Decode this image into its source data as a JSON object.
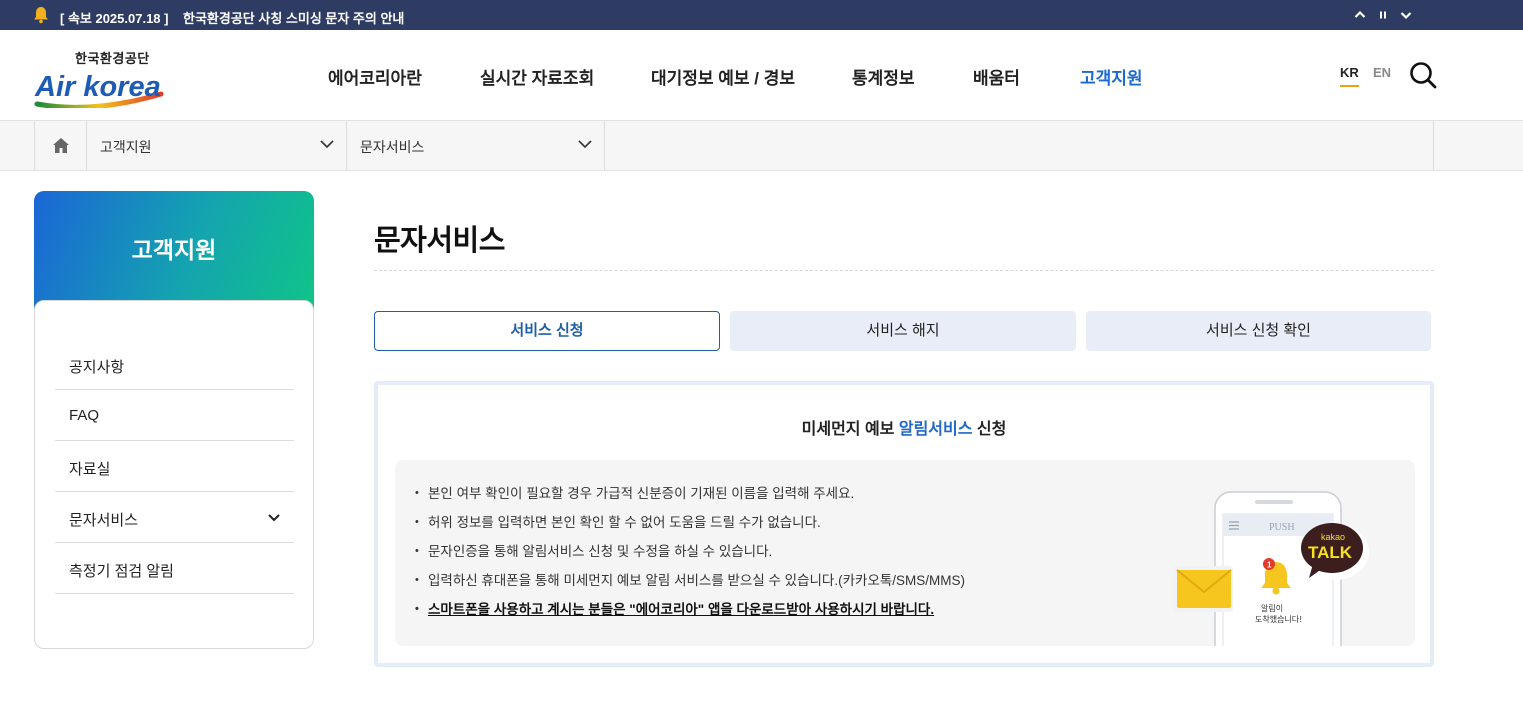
{
  "alert": {
    "tag": "[ 속보 2025.07.18 ]",
    "message": "한국환경공단 사칭 스미싱 문자 주의 안내"
  },
  "brand": {
    "name_ko": "한국환경공단",
    "logo_text": "Air korea"
  },
  "nav": {
    "items": [
      "에어코리아란",
      "실시간 자료조회",
      "대기정보 예보 / 경보",
      "통계정보",
      "배움터",
      "고객지원"
    ],
    "active_index": 5
  },
  "lang": {
    "kr": "KR",
    "en": "EN",
    "active": "KR"
  },
  "breadcrumb": {
    "level1": "고객지원",
    "level2": "문자서비스"
  },
  "sidebar": {
    "title": "고객지원",
    "items": [
      {
        "label": "공지사항"
      },
      {
        "label": "FAQ"
      },
      {
        "label": "자료실"
      },
      {
        "label": "문자서비스"
      },
      {
        "label": "측정기 점검 알림"
      }
    ]
  },
  "page": {
    "title": "문자서비스"
  },
  "tabs": [
    {
      "label": "서비스 신청",
      "selected": true
    },
    {
      "label": "서비스 해지",
      "selected": false
    },
    {
      "label": "서비스 신청 확인",
      "selected": false
    }
  ],
  "panel": {
    "title_prefix": "미세먼지 예보 ",
    "title_highlight": "알림서비스",
    "title_suffix": " 신청",
    "notes": [
      "본인 여부 확인이 필요할 경우 가급적 신분증이 기재된 이름을 입력해 주세요.",
      "허위 정보를 입력하면 본인 확인 할 수 없어 도움을 드릴 수가 없습니다.",
      "문자인증을 통해 알림서비스 신청 및 수정을 하실 수 있습니다.",
      "입력하신 휴대폰을 통해 미세먼지 예보 알림 서비스를 받으실 수 있습니다.(카카오톡/SMS/MMS)",
      "스마트폰을 사용하고 계시는 분들은 \"에어코리아\" 앱을 다운로드받아 사용하시기 바랍니다."
    ],
    "illustration": {
      "push_label": "PUSH",
      "badge_count": "1",
      "talk_small": "kakao",
      "talk_big": "TALK",
      "notice_line1": "알림이",
      "notice_line2": "도착했습니다!"
    }
  },
  "colors": {
    "alert_bg": "#2e3b63",
    "accent_blue": "#1a6ad1",
    "lang_underline": "#e8a21a",
    "kakao_bg": "#3c1e1e",
    "kakao_text": "#f7e01c"
  }
}
